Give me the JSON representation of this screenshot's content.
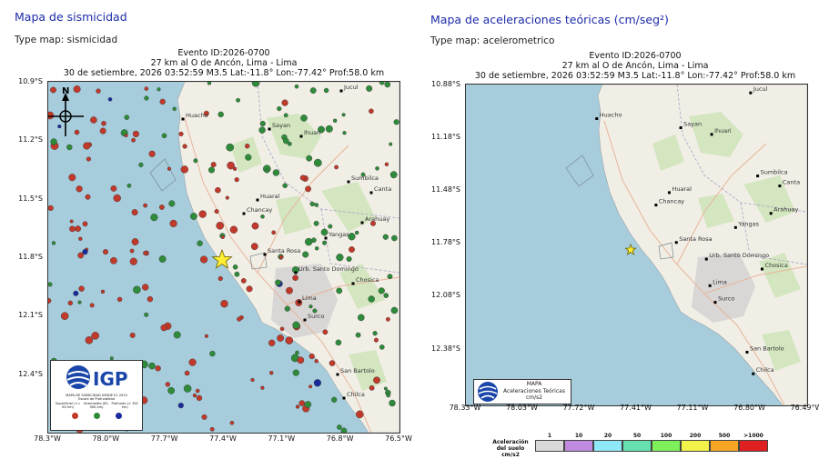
{
  "left": {
    "heading": "Mapa de sismicidad",
    "type_map": "Type map: sismicidad",
    "event_title": "Evento ID:2026-0700",
    "event_location": "27 km al O de Ancón, Lima - Lima",
    "event_details": "30 de setiembre, 2026 03:52:59 M3.5 Lat:-11.8° Lon:-77.42° Prof:58.0 km",
    "lat_labels": [
      "10.9°S",
      "11.2°S",
      "11.5°S",
      "11.8°S",
      "12.1°S",
      "12.4°S"
    ],
    "lon_labels": [
      "78.3°W",
      "78.0°W",
      "77.7°W",
      "77.4°W",
      "77.1°W",
      "76.8°W",
      "76.5°W"
    ],
    "north_label": "N",
    "places": [
      "Jucul",
      "Sayan",
      "Huacho",
      "Ihuari",
      "Sumbilca",
      "Canta",
      "Huaral",
      "Chancay",
      "Arahuay",
      "Yangas",
      "Santa Rosa",
      "Urb. Santo Domingo",
      "Chosica",
      "Lima",
      "Surco",
      "San Bartolo",
      "Chilca"
    ],
    "logo": {
      "brand": "IGP",
      "caption": "MAPA DE SISMICIDAD DESDE EL 2010",
      "scale_title": "Escala de Profundidad",
      "depth_classes": [
        "Superficial (<= 60 km)",
        "Intermedio (61-300 km)",
        "Profundo (> 301 km)"
      ],
      "depth_colors": [
        "#c0392b",
        "#2e8b3a",
        "#1a2a9c"
      ]
    }
  },
  "right": {
    "heading": "Mapa de aceleraciones teóricas (cm/seg²)",
    "type_map": "Type map: acelerometrico",
    "event_title": "Evento ID:2026-0700",
    "event_location": "27 km al O de Ancón, Lima - Lima",
    "event_details": "30 de setiembre, 2026 03:52:59 M3.5 Lat:-11.8° Lon:-77.42° Prof:58.0 km",
    "lat_labels": [
      "10.88°S",
      "11.18°S",
      "11.48°S",
      "11.78°S",
      "12.08°S",
      "12.38°S"
    ],
    "lon_labels": [
      "78.33°W",
      "78.03°W",
      "77.72°W",
      "77.41°W",
      "77.11°W",
      "76.80°W",
      "76.49°W"
    ],
    "places": [
      "Jucul",
      "Sayan",
      "Huacho",
      "Ihuari",
      "Sumbilca",
      "Canta",
      "Huaral",
      "Chancay",
      "Arahuay",
      "Yangas",
      "Santa Rosa",
      "Urb. Santo Domingo",
      "Chosica",
      "Lima",
      "Surco",
      "San Bartolo",
      "Chilca"
    ],
    "logo": {
      "line1": "MAPA",
      "line2": "Aceleraciones Teóricas",
      "line3": "cm/s2"
    },
    "scale_label": "Aceleración del suelo cm/s2",
    "scale": [
      {
        "value": "1",
        "color": "#d9d9d9"
      },
      {
        "value": "10",
        "color": "#c08ae0"
      },
      {
        "value": "20",
        "color": "#8fe8f8"
      },
      {
        "value": "50",
        "color": "#67e0b0"
      },
      {
        "value": "100",
        "color": "#7ef05a"
      },
      {
        "value": "200",
        "color": "#f2f24a"
      },
      {
        "value": "500",
        "color": "#f5a623"
      },
      {
        "value": ">1000",
        "color": "#e02020"
      }
    ]
  },
  "colors": {
    "sea": "#a7cddc",
    "land": "#f1eee6",
    "green_area": "#d3e6bf",
    "urban": "#dddada",
    "heading": "#1d2ba8",
    "epicenter": "#ffee33"
  }
}
